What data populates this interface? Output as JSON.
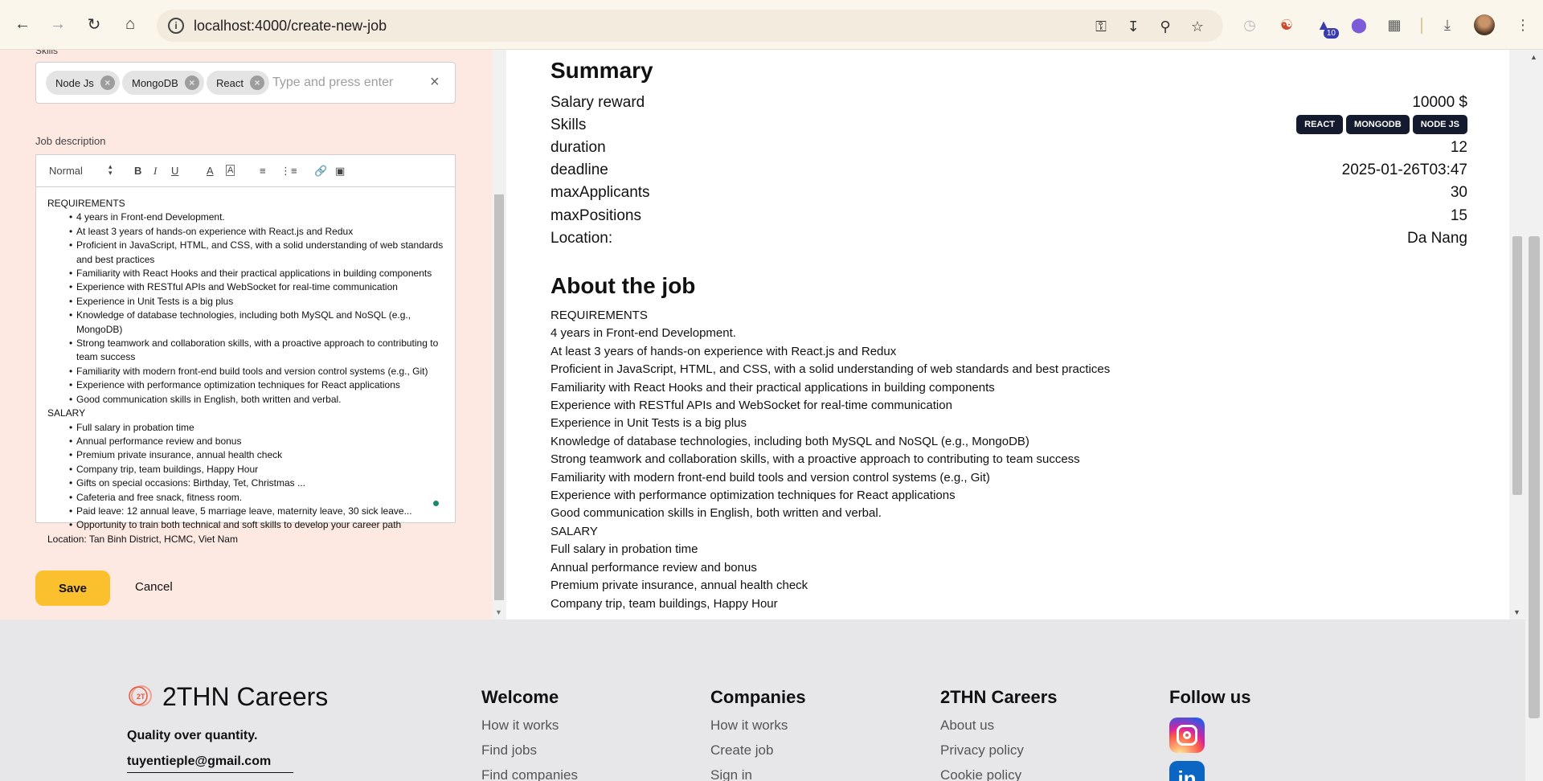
{
  "browser": {
    "url": "localhost:4000/create-new-job",
    "extension_badge": "10"
  },
  "form": {
    "skills_label": "Skills",
    "skills": [
      "Node Js",
      "MongoDB",
      "React"
    ],
    "skills_placeholder": "Type and press enter",
    "description_label": "Job description",
    "editor_format": "Normal",
    "editor_sections": [
      {
        "heading": "REQUIREMENTS",
        "items": [
          "4 years in Front-end Development.",
          "At least 3 years of hands-on experience with React.js and Redux",
          "Proficient in JavaScript, HTML, and CSS, with a solid understanding of web standards and best practices",
          "Familiarity with React Hooks and their practical applications in building components",
          "Experience with RESTful APIs and WebSocket for real-time communication",
          "Experience in Unit Tests is a big plus",
          "Knowledge of database technologies, including both MySQL and NoSQL (e.g., MongoDB)",
          "Strong teamwork and collaboration skills, with a proactive approach to contributing to team success",
          "Familiarity with modern front-end build tools and version control systems (e.g., Git)",
          "Experience with performance optimization techniques for React applications",
          "Good communication skills in English, both written and verbal."
        ]
      },
      {
        "heading": "SALARY",
        "items": [
          "Full salary in probation time",
          "Annual performance review and bonus",
          "Premium private insurance, annual health check",
          "Company trip, team buildings, Happy Hour",
          "Gifts on special occasions: Birthday, Tet, Christmas ...",
          "Cafeteria and free snack, fitness room.",
          "Paid leave: 12 annual leave, 5 marriage leave, maternity leave, 30 sick leave...",
          "Opportunity to train both technical and soft skills to develop your career path"
        ]
      }
    ],
    "editor_location_line": "Location: Tan Binh District, HCMC, Viet Nam",
    "save_label": "Save",
    "cancel_label": "Cancel"
  },
  "summary": {
    "title": "Summary",
    "rows": [
      {
        "key": "Salary reward",
        "value": "10000 $"
      },
      {
        "key": "Skills",
        "tags": [
          "REACT",
          "MONGODB",
          "NODE JS"
        ]
      },
      {
        "key": "duration",
        "value": "12"
      },
      {
        "key": "deadline",
        "value": "2025-01-26T03:47"
      },
      {
        "key": "maxApplicants",
        "value": "30"
      },
      {
        "key": "maxPositions",
        "value": "15"
      },
      {
        "key": "Location:",
        "value": "Da Nang"
      }
    ]
  },
  "about": {
    "title": "About the job",
    "lines": [
      "REQUIREMENTS",
      "4 years in Front-end Development.",
      "At least 3 years of hands-on experience with React.js and Redux",
      "Proficient in JavaScript, HTML, and CSS, with a solid understanding of web standards and best practices",
      "Familiarity with React Hooks and their practical applications in building components",
      "Experience with RESTful APIs and WebSocket for real-time communication",
      "Experience in Unit Tests is a big plus",
      "Knowledge of database technologies, including both MySQL and NoSQL (e.g., MongoDB)",
      "Strong teamwork and collaboration skills, with a proactive approach to contributing to team success",
      "Familiarity with modern front-end build tools and version control systems (e.g., Git)",
      "Experience with performance optimization techniques for React applications",
      "Good communication skills in English, both written and verbal.",
      "SALARY",
      "Full salary in probation time",
      "Annual performance review and bonus",
      "Premium private insurance, annual health check",
      "Company trip, team buildings, Happy Hour"
    ]
  },
  "footer": {
    "brand": "2THN Careers",
    "logo_text": "2T",
    "tagline": "Quality over quantity.",
    "email": "tuyentieple@gmail.com",
    "columns": [
      {
        "title": "Welcome",
        "links": [
          "How it works",
          "Find jobs",
          "Find companies"
        ]
      },
      {
        "title": "Companies",
        "links": [
          "How it works",
          "Create job",
          "Sign in"
        ]
      },
      {
        "title": "2THN Careers",
        "links": [
          "About us",
          "Privacy policy",
          "Cookie policy"
        ]
      }
    ],
    "follow_title": "Follow us",
    "linkedin_text": "in"
  }
}
